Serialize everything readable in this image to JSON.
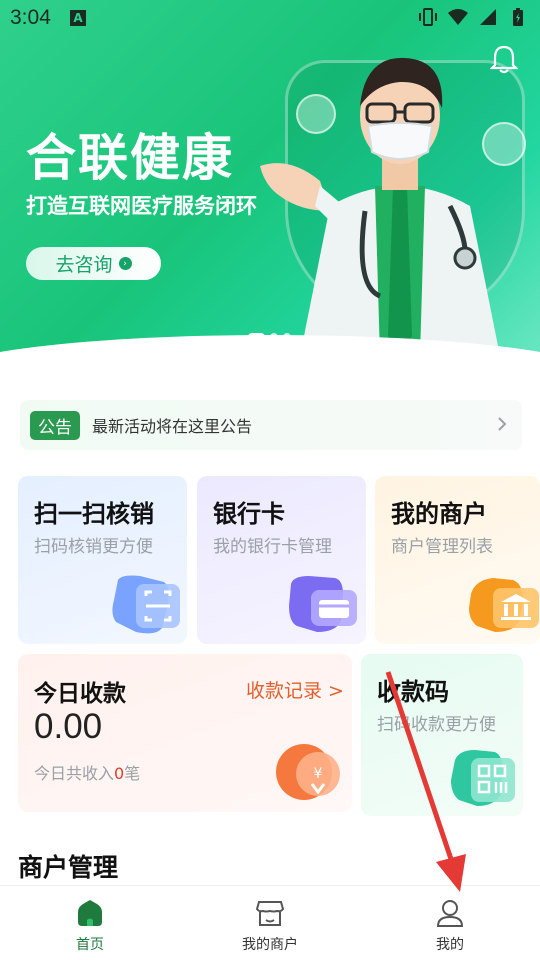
{
  "status": {
    "time": "3:04",
    "a_badge": "A"
  },
  "hero": {
    "title": "合联健康",
    "subtitle": "打造互联网医疗服务闭环",
    "button": "去咨询"
  },
  "notice": {
    "tag": "公告",
    "text": "最新活动将在这里公告"
  },
  "cards": {
    "scan": {
      "title": "扫一扫核销",
      "sub": "扫码核销更方便"
    },
    "bank": {
      "title": "银行卡",
      "sub": "我的银行卡管理"
    },
    "merchant": {
      "title": "我的商户",
      "sub": "商户管理列表"
    },
    "qrcode": {
      "title": "收款码",
      "sub": "扫码收款更方便"
    }
  },
  "today": {
    "title": "今日收款",
    "link": "收款记录 >",
    "amount": "0.00",
    "total_prefix": "今日共收入",
    "total_count": "0",
    "total_suffix": "笔"
  },
  "section": {
    "title": "商户管理"
  },
  "nav": [
    {
      "label": "首页"
    },
    {
      "label": "我的商户"
    },
    {
      "label": "我的"
    }
  ],
  "colors": {
    "accent": "#19c47a",
    "nav_active": "#1f7a3d",
    "link": "#e2602d"
  }
}
